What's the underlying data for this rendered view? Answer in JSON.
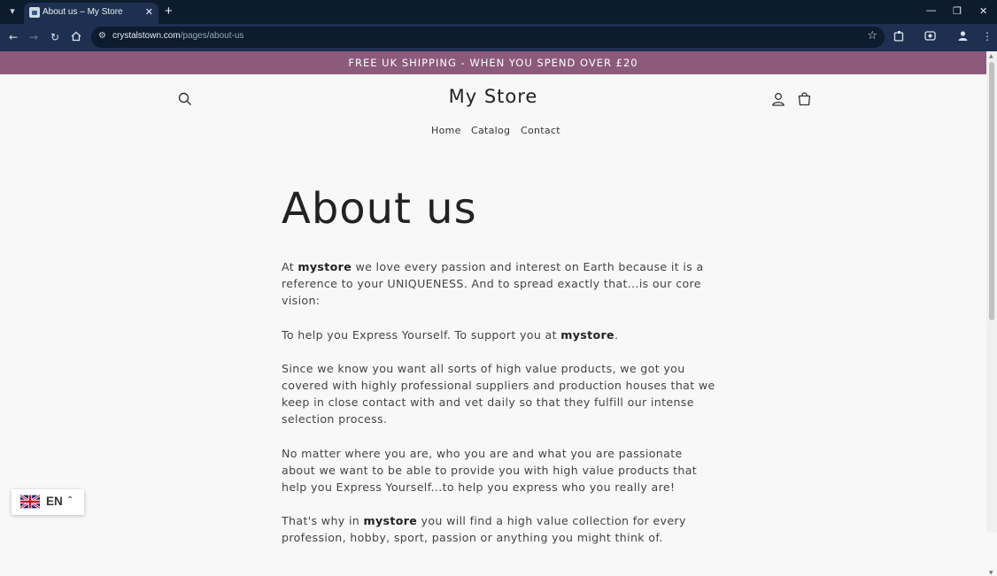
{
  "browser": {
    "tab_title": "About us – My Store",
    "tab_close": "✕",
    "new_tab": "+",
    "url_host": "crystalstown.com",
    "url_path": "/pages/about-us"
  },
  "announcement": "FREE UK SHIPPING - WHEN YOU SPEND OVER £20",
  "header": {
    "store_name": "My Store",
    "menu": [
      "Home",
      "Catalog",
      "Contact"
    ]
  },
  "page": {
    "title": "About us",
    "paragraphs": [
      {
        "before": "At ",
        "bold": "mystore",
        "after": " we love every passion and interest on Earth because it is a reference to your UNIQUENESS. And to spread exactly that...is our core vision:"
      },
      {
        "before": "To help you Express Yourself. To support you at ",
        "bold": "mystore",
        "after": "."
      },
      {
        "before": "Since we know you want all sorts of high value products, we got you covered with highly professional suppliers and production houses that we keep in close contact with and vet daily so that they fulfill our intense selection process.",
        "bold": "",
        "after": ""
      },
      {
        "before": "No matter where you are, who you are and what you are passionate about we want to be able to provide you with high value products that help you Express Yourself...to help you express who you really are!",
        "bold": "",
        "after": ""
      },
      {
        "before": "That's why in ",
        "bold": "mystore",
        "after": " you will find a high value collection for every profession, hobby, sport, passion or anything you might think of."
      }
    ]
  },
  "language": {
    "code": "EN"
  },
  "colors": {
    "announcement_bg": "#8c5a7b",
    "page_bg": "#f8f8f8",
    "browser_dark": "#0d1b2e",
    "browser_toolbar": "#1e3050"
  }
}
